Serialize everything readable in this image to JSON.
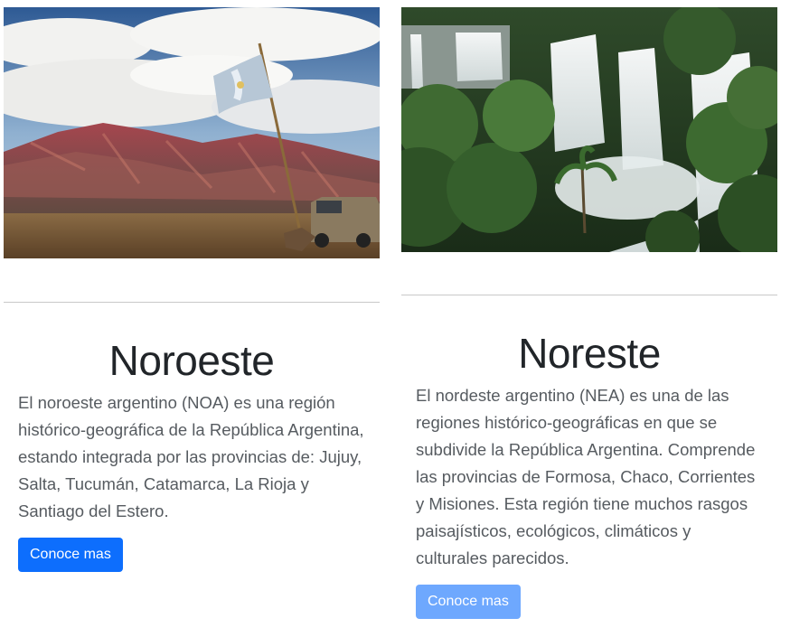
{
  "cards": [
    {
      "image": "mountains-flag-photo",
      "title": "Noroeste",
      "description": "El noroeste argentino (NOA) es una región histórico-geográfica de la República Argentina, estando integrada por las provincias de: Jujuy, Salta, Tucumán, Catamarca, La Rioja y Santiago del Estero.",
      "button_label": "Conoce mas",
      "button_color": "#0d6efd"
    },
    {
      "image": "waterfalls-jungle-photo",
      "title": "Noreste",
      "description": "El nordeste argentino (NEA) es una de las regiones histórico-geográficas en que se subdivide la República Argentina. Comprende las provincias de Formosa, Chaco, Corrientes y Misiones. Esta región tiene muchos rasgos paisajísticos, ecológicos, climáticos y culturales parecidos.",
      "button_label": "Conoce mas",
      "button_color": "#6ea8fe"
    }
  ]
}
